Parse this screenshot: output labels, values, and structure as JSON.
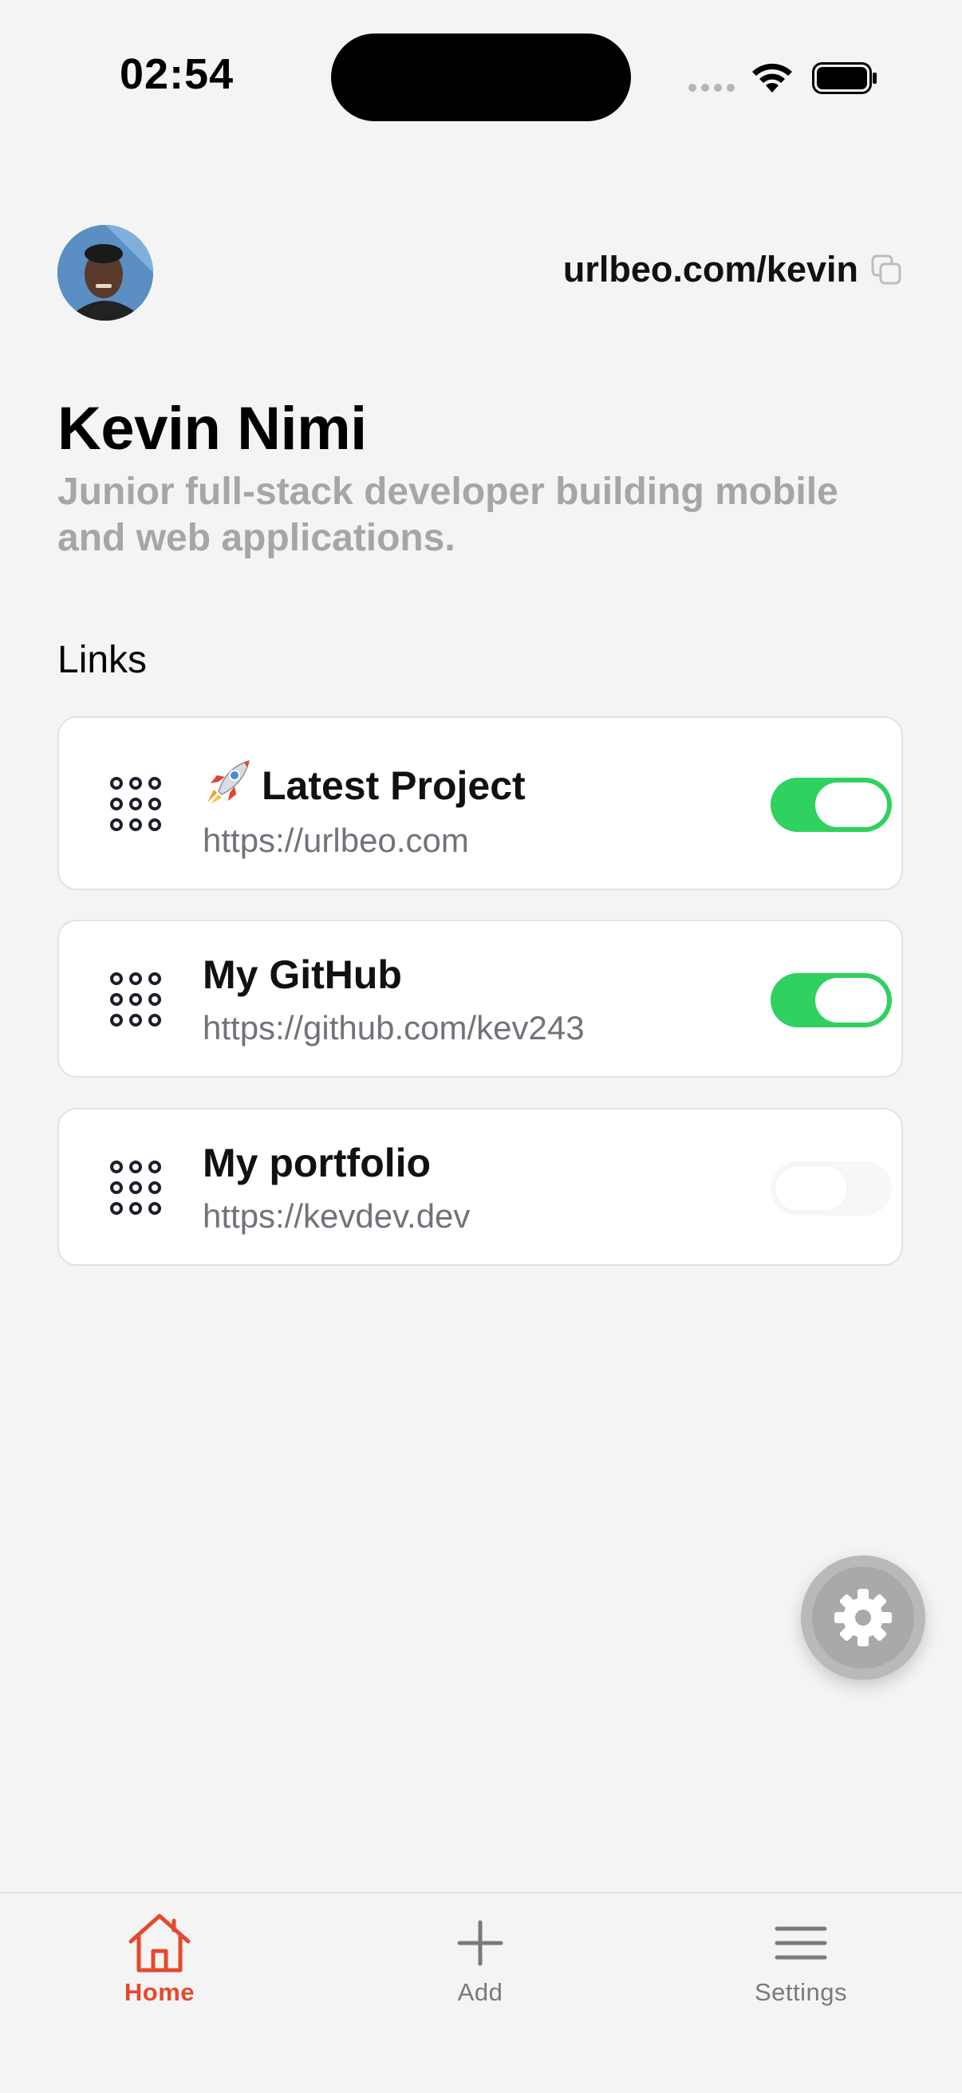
{
  "status_bar": {
    "time": "02:54"
  },
  "profile": {
    "url": "urlbeo.com/kevin",
    "name": "Kevin Nimi",
    "bio": "Junior full-stack developer building mobile and web applications."
  },
  "links_section": {
    "heading": "Links",
    "items": [
      {
        "title": "Latest Project",
        "url": "https://urlbeo.com",
        "enabled": true,
        "emoji_icon": "rocket-icon"
      },
      {
        "title": "My GitHub",
        "url": "https://github.com/kev243",
        "enabled": true
      },
      {
        "title": "My portfolio",
        "url": "https://kevdev.dev",
        "enabled": false
      }
    ]
  },
  "tab_bar": {
    "items": [
      {
        "label": "Home",
        "icon": "home-icon",
        "active": true
      },
      {
        "label": "Add",
        "icon": "plus-icon",
        "active": false
      },
      {
        "label": "Settings",
        "icon": "menu-icon",
        "active": false
      }
    ]
  },
  "colors": {
    "accent": "#e4492c",
    "toggle_on": "#2fd15f",
    "background": "#f4f4f4",
    "muted_text": "#a6a6a6"
  }
}
